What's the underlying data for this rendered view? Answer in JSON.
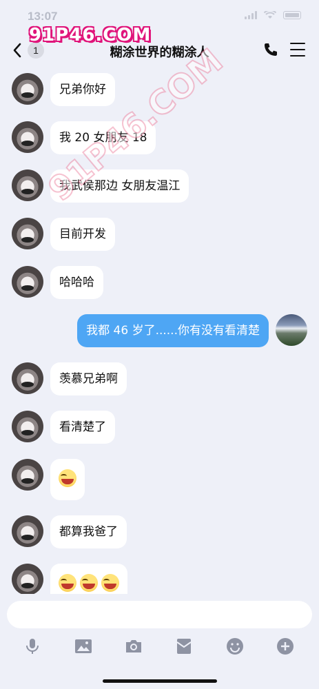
{
  "status": {
    "time": "13:07"
  },
  "watermark": {
    "logo": "91P46.COM",
    "diagonal": "91P46.COM"
  },
  "nav": {
    "back_badge": "1",
    "title": "糊涂世界的糊涂人"
  },
  "messages": [
    {
      "side": "left",
      "text": "兄弟你好"
    },
    {
      "side": "left",
      "text": "我 20 女朋友 18"
    },
    {
      "side": "left",
      "text": "我武侯那边 女朋友温江"
    },
    {
      "side": "left",
      "text": "目前开发"
    },
    {
      "side": "left",
      "text": "哈哈哈"
    },
    {
      "side": "right",
      "text": "我都 46 岁了......你有没有看清楚"
    },
    {
      "side": "left",
      "text": "羡慕兄弟啊"
    },
    {
      "side": "left",
      "text": "看清楚了"
    },
    {
      "side": "left",
      "emoji_count": 1,
      "emoji": "laughing-tears-emoji"
    },
    {
      "side": "left",
      "text": "都算我爸了"
    },
    {
      "side": "left",
      "emoji_count": 3,
      "emoji": "laughing-tears-emoji"
    }
  ],
  "input": {
    "placeholder": ""
  },
  "toolbar": [
    "microphone-icon",
    "image-icon",
    "camera-icon",
    "red-packet-icon",
    "emoji-icon",
    "plus-icon"
  ],
  "colors": {
    "background": "#eef0f8",
    "my_bubble": "#4ea6f4",
    "their_bubble": "#ffffff"
  }
}
